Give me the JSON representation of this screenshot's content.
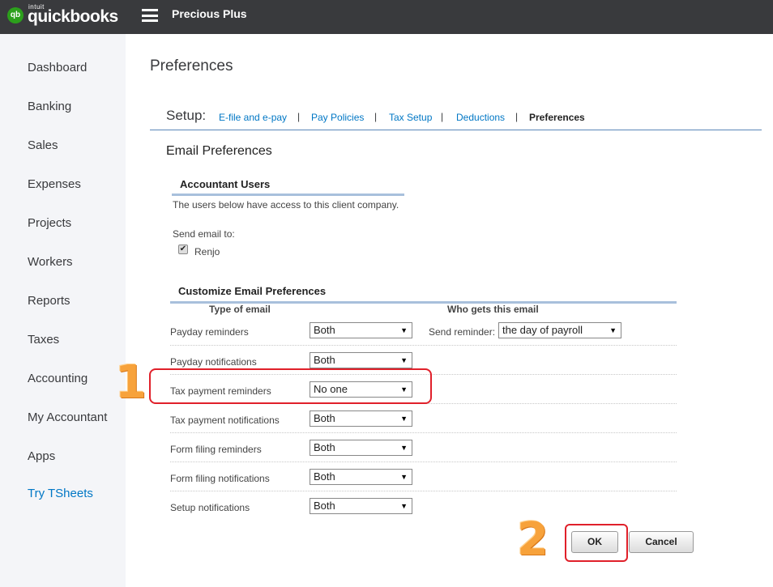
{
  "topbar": {
    "logo_badge": "qb",
    "logo_intuit": "intuit",
    "logo_name": "quickbooks",
    "company_name": "Precious Plus"
  },
  "sidebar": {
    "items": [
      {
        "label": "Dashboard"
      },
      {
        "label": "Banking"
      },
      {
        "label": "Sales"
      },
      {
        "label": "Expenses"
      },
      {
        "label": "Projects"
      },
      {
        "label": "Workers"
      },
      {
        "label": "Reports"
      },
      {
        "label": "Taxes"
      },
      {
        "label": "Accounting"
      },
      {
        "label": "My Accountant"
      },
      {
        "label": "Apps"
      },
      {
        "label": "Try TSheets"
      }
    ]
  },
  "page": {
    "title": "Preferences"
  },
  "setup": {
    "label": "Setup:",
    "links": [
      "E-file and e-pay",
      "Pay Policies",
      "Tax Setup",
      "Deductions"
    ],
    "current": "Preferences",
    "separator": "|"
  },
  "email_prefs": {
    "title": "Email Preferences",
    "accountant_users": {
      "title": "Accountant Users",
      "description": "The users below have access to this client company.",
      "send_email_label": "Send email to:",
      "users": [
        {
          "name": "Renjo",
          "checked": true
        }
      ]
    },
    "customize": {
      "title": "Customize Email Preferences",
      "col_type": "Type of email",
      "col_who": "Who gets this email",
      "send_reminder_label": "Send reminder:",
      "send_reminder_value": "the day of payroll",
      "rows": [
        {
          "label": "Payday reminders",
          "value": "Both"
        },
        {
          "label": "Payday notifications",
          "value": "Both"
        },
        {
          "label": "Tax payment reminders",
          "value": "No one"
        },
        {
          "label": "Tax payment notifications",
          "value": "Both"
        },
        {
          "label": "Form filing reminders",
          "value": "Both"
        },
        {
          "label": "Form filing notifications",
          "value": "Both"
        },
        {
          "label": "Setup notifications",
          "value": "Both"
        }
      ]
    }
  },
  "annotations": {
    "step1": "1",
    "step2": "2"
  },
  "buttons": {
    "ok": "OK",
    "cancel": "Cancel"
  },
  "colors": {
    "accent": "#0077c5",
    "topbar": "#393a3d",
    "brand_green": "#2ca01c",
    "highlight": "#e0202a",
    "step_number": "#f7a23b"
  }
}
